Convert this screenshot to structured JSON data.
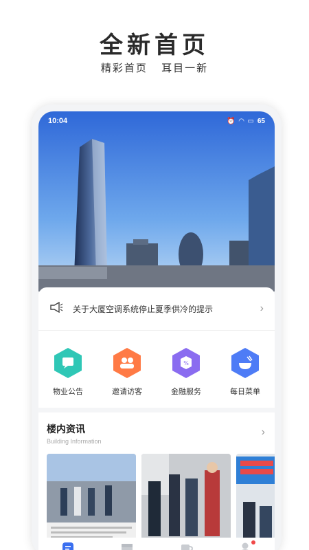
{
  "promo": {
    "title": "全新首页",
    "subtitle": "精彩首页  耳目一新"
  },
  "status": {
    "time": "10:04",
    "battery": "65"
  },
  "notice": {
    "icon": "megaphone-icon",
    "text": "关于大厦空调系统停止夏季供冷的提示"
  },
  "quick_links": [
    {
      "label": "物业公告",
      "icon": "message-icon",
      "color": "#2fc7b6"
    },
    {
      "label": "邀请访客",
      "icon": "users-icon",
      "color": "#ff7a45"
    },
    {
      "label": "金融服务",
      "icon": "finance-icon",
      "color": "#8a6cf0"
    },
    {
      "label": "每日菜单",
      "icon": "bowl-icon",
      "color": "#4e7cf6"
    }
  ],
  "news": {
    "title": "楼内资讯",
    "subtitle": "Building Information"
  },
  "colors": {
    "accent": "#3a6ff0",
    "badge": "#f04848"
  }
}
